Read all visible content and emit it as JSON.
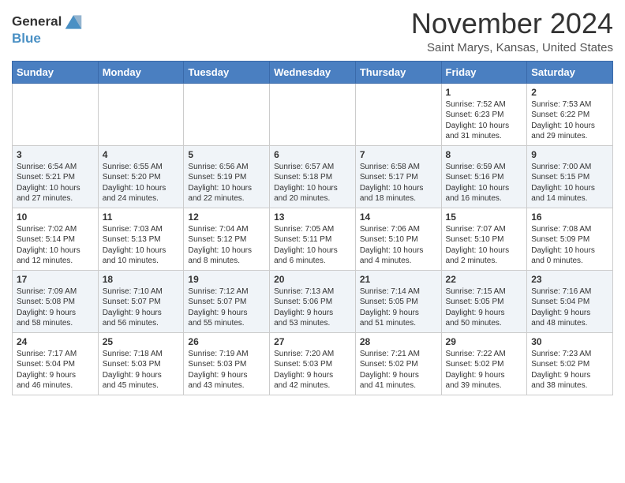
{
  "header": {
    "logo_general": "General",
    "logo_blue": "Blue",
    "month_title": "November 2024",
    "location": "Saint Marys, Kansas, United States"
  },
  "calendar": {
    "days_of_week": [
      "Sunday",
      "Monday",
      "Tuesday",
      "Wednesday",
      "Thursday",
      "Friday",
      "Saturday"
    ],
    "weeks": [
      [
        {
          "day": "",
          "text": ""
        },
        {
          "day": "",
          "text": ""
        },
        {
          "day": "",
          "text": ""
        },
        {
          "day": "",
          "text": ""
        },
        {
          "day": "",
          "text": ""
        },
        {
          "day": "1",
          "text": "Sunrise: 7:52 AM\nSunset: 6:23 PM\nDaylight: 10 hours\nand 31 minutes."
        },
        {
          "day": "2",
          "text": "Sunrise: 7:53 AM\nSunset: 6:22 PM\nDaylight: 10 hours\nand 29 minutes."
        }
      ],
      [
        {
          "day": "3",
          "text": "Sunrise: 6:54 AM\nSunset: 5:21 PM\nDaylight: 10 hours\nand 27 minutes."
        },
        {
          "day": "4",
          "text": "Sunrise: 6:55 AM\nSunset: 5:20 PM\nDaylight: 10 hours\nand 24 minutes."
        },
        {
          "day": "5",
          "text": "Sunrise: 6:56 AM\nSunset: 5:19 PM\nDaylight: 10 hours\nand 22 minutes."
        },
        {
          "day": "6",
          "text": "Sunrise: 6:57 AM\nSunset: 5:18 PM\nDaylight: 10 hours\nand 20 minutes."
        },
        {
          "day": "7",
          "text": "Sunrise: 6:58 AM\nSunset: 5:17 PM\nDaylight: 10 hours\nand 18 minutes."
        },
        {
          "day": "8",
          "text": "Sunrise: 6:59 AM\nSunset: 5:16 PM\nDaylight: 10 hours\nand 16 minutes."
        },
        {
          "day": "9",
          "text": "Sunrise: 7:00 AM\nSunset: 5:15 PM\nDaylight: 10 hours\nand 14 minutes."
        }
      ],
      [
        {
          "day": "10",
          "text": "Sunrise: 7:02 AM\nSunset: 5:14 PM\nDaylight: 10 hours\nand 12 minutes."
        },
        {
          "day": "11",
          "text": "Sunrise: 7:03 AM\nSunset: 5:13 PM\nDaylight: 10 hours\nand 10 minutes."
        },
        {
          "day": "12",
          "text": "Sunrise: 7:04 AM\nSunset: 5:12 PM\nDaylight: 10 hours\nand 8 minutes."
        },
        {
          "day": "13",
          "text": "Sunrise: 7:05 AM\nSunset: 5:11 PM\nDaylight: 10 hours\nand 6 minutes."
        },
        {
          "day": "14",
          "text": "Sunrise: 7:06 AM\nSunset: 5:10 PM\nDaylight: 10 hours\nand 4 minutes."
        },
        {
          "day": "15",
          "text": "Sunrise: 7:07 AM\nSunset: 5:10 PM\nDaylight: 10 hours\nand 2 minutes."
        },
        {
          "day": "16",
          "text": "Sunrise: 7:08 AM\nSunset: 5:09 PM\nDaylight: 10 hours\nand 0 minutes."
        }
      ],
      [
        {
          "day": "17",
          "text": "Sunrise: 7:09 AM\nSunset: 5:08 PM\nDaylight: 9 hours\nand 58 minutes."
        },
        {
          "day": "18",
          "text": "Sunrise: 7:10 AM\nSunset: 5:07 PM\nDaylight: 9 hours\nand 56 minutes."
        },
        {
          "day": "19",
          "text": "Sunrise: 7:12 AM\nSunset: 5:07 PM\nDaylight: 9 hours\nand 55 minutes."
        },
        {
          "day": "20",
          "text": "Sunrise: 7:13 AM\nSunset: 5:06 PM\nDaylight: 9 hours\nand 53 minutes."
        },
        {
          "day": "21",
          "text": "Sunrise: 7:14 AM\nSunset: 5:05 PM\nDaylight: 9 hours\nand 51 minutes."
        },
        {
          "day": "22",
          "text": "Sunrise: 7:15 AM\nSunset: 5:05 PM\nDaylight: 9 hours\nand 50 minutes."
        },
        {
          "day": "23",
          "text": "Sunrise: 7:16 AM\nSunset: 5:04 PM\nDaylight: 9 hours\nand 48 minutes."
        }
      ],
      [
        {
          "day": "24",
          "text": "Sunrise: 7:17 AM\nSunset: 5:04 PM\nDaylight: 9 hours\nand 46 minutes."
        },
        {
          "day": "25",
          "text": "Sunrise: 7:18 AM\nSunset: 5:03 PM\nDaylight: 9 hours\nand 45 minutes."
        },
        {
          "day": "26",
          "text": "Sunrise: 7:19 AM\nSunset: 5:03 PM\nDaylight: 9 hours\nand 43 minutes."
        },
        {
          "day": "27",
          "text": "Sunrise: 7:20 AM\nSunset: 5:03 PM\nDaylight: 9 hours\nand 42 minutes."
        },
        {
          "day": "28",
          "text": "Sunrise: 7:21 AM\nSunset: 5:02 PM\nDaylight: 9 hours\nand 41 minutes."
        },
        {
          "day": "29",
          "text": "Sunrise: 7:22 AM\nSunset: 5:02 PM\nDaylight: 9 hours\nand 39 minutes."
        },
        {
          "day": "30",
          "text": "Sunrise: 7:23 AM\nSunset: 5:02 PM\nDaylight: 9 hours\nand 38 minutes."
        }
      ]
    ]
  }
}
